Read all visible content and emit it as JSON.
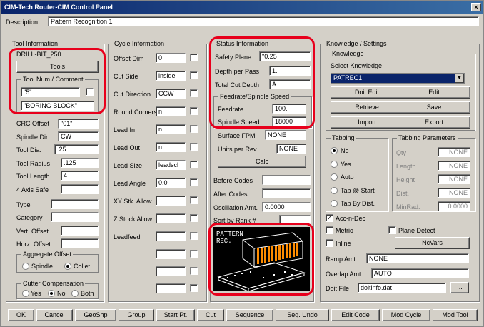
{
  "window": {
    "title": "CIM-Tech Router-CIM Control Panel",
    "close": "×"
  },
  "description": {
    "label": "Description",
    "value": "Pattern Recognition 1"
  },
  "tool": {
    "group": "Tool Information",
    "name": "DRILL-BIT_250",
    "tools_btn": "Tools",
    "num_group": "Tool Num / Comment",
    "num": "\"5\"",
    "comment": "\"BORING BLOCK\"",
    "crc_label": "CRC Offset",
    "crc": "\"01\"",
    "spindle_dir_label": "Spindle Dir",
    "spindle_dir": "CW",
    "dia_label": "Tool Dia.",
    "dia": ".25",
    "radius_label": "Tool Radius",
    "radius": ".125",
    "length_label": "Tool Length",
    "length": "4",
    "axis_label": "4 Axis Safe",
    "type_label": "Type",
    "category_label": "Category",
    "vert_label": "Vert. Offset",
    "horz_label": "Horz. Offset"
  },
  "aggregate": {
    "group": "Aggregate Offset",
    "spindle": "Spindle",
    "collet": "Collet"
  },
  "cutter": {
    "group": "Cutter Compensation",
    "yes": "Yes",
    "no": "No",
    "both": "Both"
  },
  "cycle": {
    "group": "Cycle Information",
    "offset_dim": "Offset Dim",
    "offset_dim_val": "0",
    "cut_side": "Cut Side",
    "cut_side_val": "inside",
    "cut_dir": "Cut Direction",
    "cut_dir_val": "CCW",
    "round": "Round Corners",
    "round_val": "n",
    "lead_in": "Lead In",
    "lead_in_val": "n",
    "lead_out": "Lead Out",
    "lead_out_val": "n",
    "lead_size": "Lead Size",
    "lead_size_val": "leadscl",
    "lead_angle": "Lead Angle",
    "lead_angle_val": "0.0",
    "xy": "XY Stk. Allow.",
    "z": "Z Stock Allow.",
    "leadfeed": "Leadfeed"
  },
  "status": {
    "group": "Status Information",
    "safety": "Safety Plane",
    "safety_val": "\"0.25",
    "depth_pass": "Depth per Pass",
    "depth_pass_val": "1.",
    "total": "Total Cut Depth",
    "total_val": "A",
    "fs_group": "Feedrate/Spindle Speed",
    "feed": "Feedrate",
    "feed_val": "100.",
    "speed": "Spindle Speed",
    "speed_val": "18000",
    "fpm": "Surface FPM",
    "fpm_val": "NONE",
    "units": "Units per Rev.",
    "units_val": "NONE",
    "calc": "Calc",
    "before": "Before Codes",
    "after": "After Codes",
    "osc": "Oscillation Amt.",
    "osc_val": "0.0000",
    "sort": "Sort by Rank #"
  },
  "preview": {
    "line1": "PATTERN",
    "line2": "REC."
  },
  "knowledge": {
    "group": "Knowledge / Settings",
    "sub": "Knowledge",
    "select": "Select Knowledge",
    "selected": "PATREC1",
    "doit_edit": "Doit Edit",
    "edit": "Edit",
    "retrieve": "Retrieve",
    "save": "Save",
    "import": "Import",
    "export": "Export"
  },
  "tabbing": {
    "group": "Tabbing",
    "no": "No",
    "yes": "Yes",
    "auto": "Auto",
    "start": "Tab @ Start",
    "dist": "Tab By Dist."
  },
  "tabparams": {
    "group": "Tabbing Parameters",
    "qty": "Qty",
    "length": "Length",
    "height": "Height",
    "dist": "Dist.",
    "minrad": "MinRad.",
    "none": "NONE",
    "minrad_val": "0.0000"
  },
  "settings": {
    "acc": "Acc-n-Dec",
    "metric": "Metric",
    "plane": "Plane Detect",
    "inline": "Inline",
    "ncvars": "NcVars",
    "ramp": "Ramp Amt.",
    "ramp_val": "NONE",
    "overlap": "Overlap Amt",
    "overlap_val": "AUTO",
    "doit": "Doit File",
    "doit_val": "doitinfo.dat",
    "browse": "..."
  },
  "bottom": [
    "OK",
    "Cancel",
    "GeoShp",
    "Group",
    "Start Pt.",
    "Cut",
    "Sequence",
    "Seq. Undo",
    "Edit Code",
    "Mod Cycle",
    "Mod Tool"
  ]
}
